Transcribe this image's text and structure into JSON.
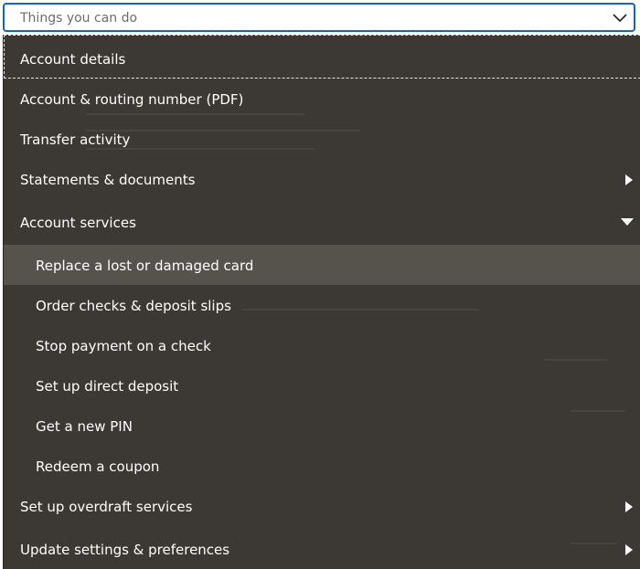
{
  "select": {
    "placeholder": "Things you can do",
    "chevron_icon": "chevron-down-icon"
  },
  "menu": {
    "items": [
      {
        "label": "Account details",
        "state": "focused"
      },
      {
        "label": "Account & routing number (PDF)"
      },
      {
        "label": "Transfer activity"
      },
      {
        "label": "Statements & documents",
        "icon": "chevron-right-icon"
      },
      {
        "label": "Account services",
        "icon": "caret-down-icon",
        "expanded": true
      },
      {
        "label": "Replace a lost or damaged card",
        "submenu": true,
        "state": "hover"
      },
      {
        "label": "Order checks & deposit slips",
        "submenu": true
      },
      {
        "label": "Stop payment on a check",
        "submenu": true
      },
      {
        "label": "Set up direct deposit",
        "submenu": true
      },
      {
        "label": "Get a new PIN",
        "submenu": true
      },
      {
        "label": "Redeem a coupon",
        "submenu": true
      },
      {
        "label": "Set up overdraft services",
        "icon": "chevron-right-icon"
      },
      {
        "label": "Update settings & preferences",
        "icon": "chevron-right-icon"
      }
    ]
  },
  "colors": {
    "menu_background": "#3c3834",
    "hover_background": "#56524c",
    "focus_border": "#1565c0",
    "text": "#ffffff"
  }
}
